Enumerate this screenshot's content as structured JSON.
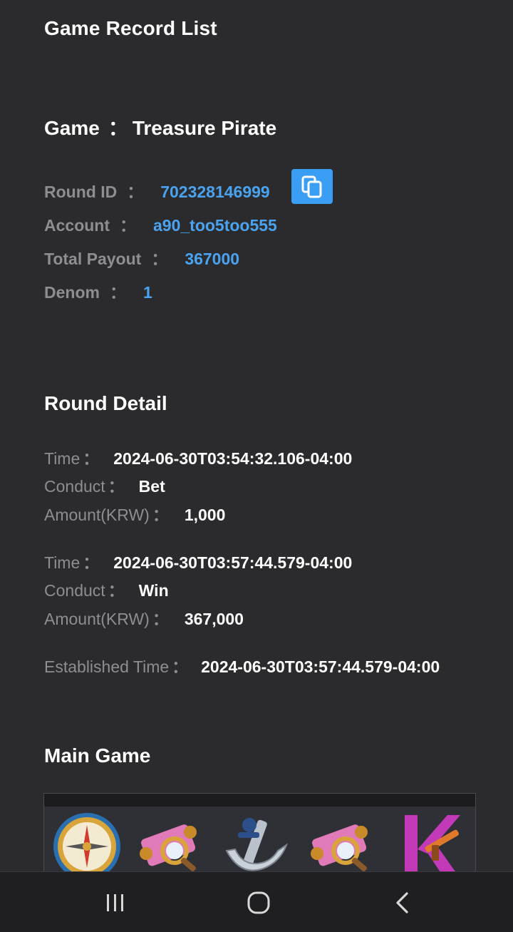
{
  "header": {
    "title": "Game Record List"
  },
  "game": {
    "label": "Game",
    "separator": "：",
    "name": "Treasure Pirate"
  },
  "summary": {
    "round_id": {
      "label": "Round ID",
      "value": "702328146999"
    },
    "account": {
      "label": "Account",
      "value": "a90_too5too555"
    },
    "total_payout": {
      "label": "Total Payout",
      "value": "367000"
    },
    "denom": {
      "label": "Denom",
      "value": "1"
    },
    "colon": "："
  },
  "round_detail": {
    "title": "Round Detail",
    "time_label": "Time",
    "conduct_label": "Conduct",
    "amount_label": "Amount",
    "amount_unit": "(KRW)",
    "entries": [
      {
        "time": "2024-06-30T03:54:32.106-04:00",
        "conduct": "Bet",
        "amount": "1,000"
      },
      {
        "time": "2024-06-30T03:57:44.579-04:00",
        "conduct": "Win",
        "amount": "367,000"
      }
    ],
    "established_label": "Established Time",
    "established_time": "2024-06-30T03:57:44.579-04:00"
  },
  "main_game": {
    "title": "Main Game",
    "symbols": [
      "compass-symbol",
      "treasure-map-symbol",
      "anchor-symbol",
      "treasure-map-symbol",
      "k-symbol"
    ]
  },
  "nav": {
    "icons": [
      "recent-apps-icon",
      "home-icon",
      "back-icon"
    ]
  },
  "colors": {
    "accent": "#3b9ef5",
    "value_blue": "#4aa3f0",
    "background": "#2b2b2d",
    "label_gray": "#8e8e92"
  }
}
